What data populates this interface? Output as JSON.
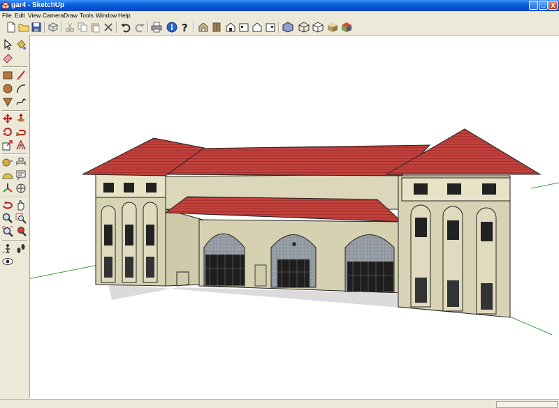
{
  "window": {
    "title": "gar4 - SketchUp"
  },
  "window_controls": {
    "minimize": "_",
    "maximize": "□",
    "close": "X"
  },
  "menu": [
    "File",
    "Edit",
    "View",
    "Camera",
    "Draw",
    "Tools",
    "Window",
    "Help"
  ],
  "toolbar": {
    "file_tools": [
      "new-file-icon",
      "open-folder-icon",
      "save-icon",
      "make-component-icon"
    ],
    "edit_tools": [
      "cut-icon",
      "copy-icon",
      "paste-icon",
      "erase-icon"
    ],
    "history_tools": [
      "undo-icon",
      "redo-icon"
    ],
    "misc_tools": [
      "print-icon",
      "model-info-icon",
      "help-icon"
    ],
    "view_tools": [
      "iso-view-icon",
      "top-view-icon",
      "front-view-icon",
      "right-view-icon",
      "back-view-icon",
      "left-view-icon"
    ],
    "style_tools": [
      "xray-style-icon",
      "wireframe-style-icon",
      "hidden-line-style-icon",
      "shaded-style-icon",
      "shaded-textures-style-icon"
    ]
  },
  "tool_palette": [
    "select-tool-icon",
    "paint-bucket-icon",
    "eraser-icon",
    "rectangle-tool-icon",
    "line-tool-icon",
    "circle-tool-icon",
    "arc-tool-icon",
    "polygon-tool-icon",
    "freehand-tool-icon",
    "move-tool-icon",
    "push-pull-tool-icon",
    "rotate-tool-icon",
    "follow-me-tool-icon",
    "scale-tool-icon",
    "offset-tool-icon",
    "tape-measure-tool-icon",
    "dimension-tool-icon",
    "protractor-tool-icon",
    "text-tool-icon",
    "axes-tool-icon",
    "3d-text-tool-icon",
    "orbit-tool-icon",
    "pan-tool-icon",
    "zoom-tool-icon",
    "zoom-window-tool-icon",
    "zoom-extents-tool-icon",
    "previous-view-tool-icon",
    "position-camera-tool-icon",
    "walk-tool-icon",
    "look-around-tool-icon"
  ],
  "colors": {
    "title_blue": "#0a5fd8",
    "roof_red": "#c0403c",
    "wall_beige": "#d8d3b4",
    "axis_green": "#3a9a3a",
    "axis_red": "#d04040"
  }
}
